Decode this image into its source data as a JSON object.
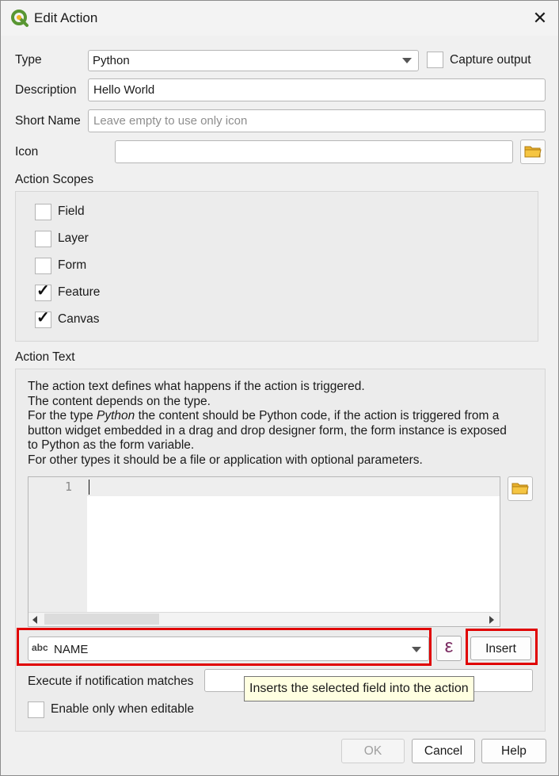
{
  "window": {
    "title": "Edit Action",
    "close_label": "✕"
  },
  "form": {
    "type_label": "Type",
    "type_value": "Python",
    "capture_output_label": "Capture output",
    "capture_output_checked": false,
    "description_label": "Description",
    "description_value": "Hello World",
    "short_name_label": "Short Name",
    "short_name_placeholder": "Leave empty to use only icon",
    "icon_label": "Icon",
    "icon_value": ""
  },
  "scopes": {
    "label": "Action Scopes",
    "items": [
      {
        "label": "Field",
        "checked": false
      },
      {
        "label": "Layer",
        "checked": false
      },
      {
        "label": "Form",
        "checked": false
      },
      {
        "label": "Feature",
        "checked": true
      },
      {
        "label": "Canvas",
        "checked": true
      }
    ]
  },
  "action_text": {
    "label": "Action Text",
    "lines": [
      "The action text defines what happens if the action is triggered.",
      "The content depends on the type.",
      "button widget embedded in a drag and drop designer form, the form instance is exposed",
      "to Python as the form variable.",
      "For other types it should be a file or application with optional parameters."
    ],
    "line3_prefix": "For the type ",
    "line3_emph": "Python",
    "line3_suffix": " the content should be Python code, if the action is triggered from a",
    "editor_line_number": "1",
    "editor_text": ""
  },
  "field_row": {
    "type_badge": "abc",
    "field_value": "NAME",
    "expression_icon": "ε",
    "insert_label": "Insert"
  },
  "notification": {
    "label": "Execute if notification matches",
    "value": "",
    "tooltip": "Inserts the selected field into the action"
  },
  "enable_only_editable": {
    "label": "Enable only when editable",
    "checked": false
  },
  "buttons": {
    "ok": "OK",
    "cancel": "Cancel",
    "help": "Help"
  },
  "colors": {
    "highlight": "#e00000",
    "qgis_green": "#589632",
    "folder": "#f5c542"
  }
}
